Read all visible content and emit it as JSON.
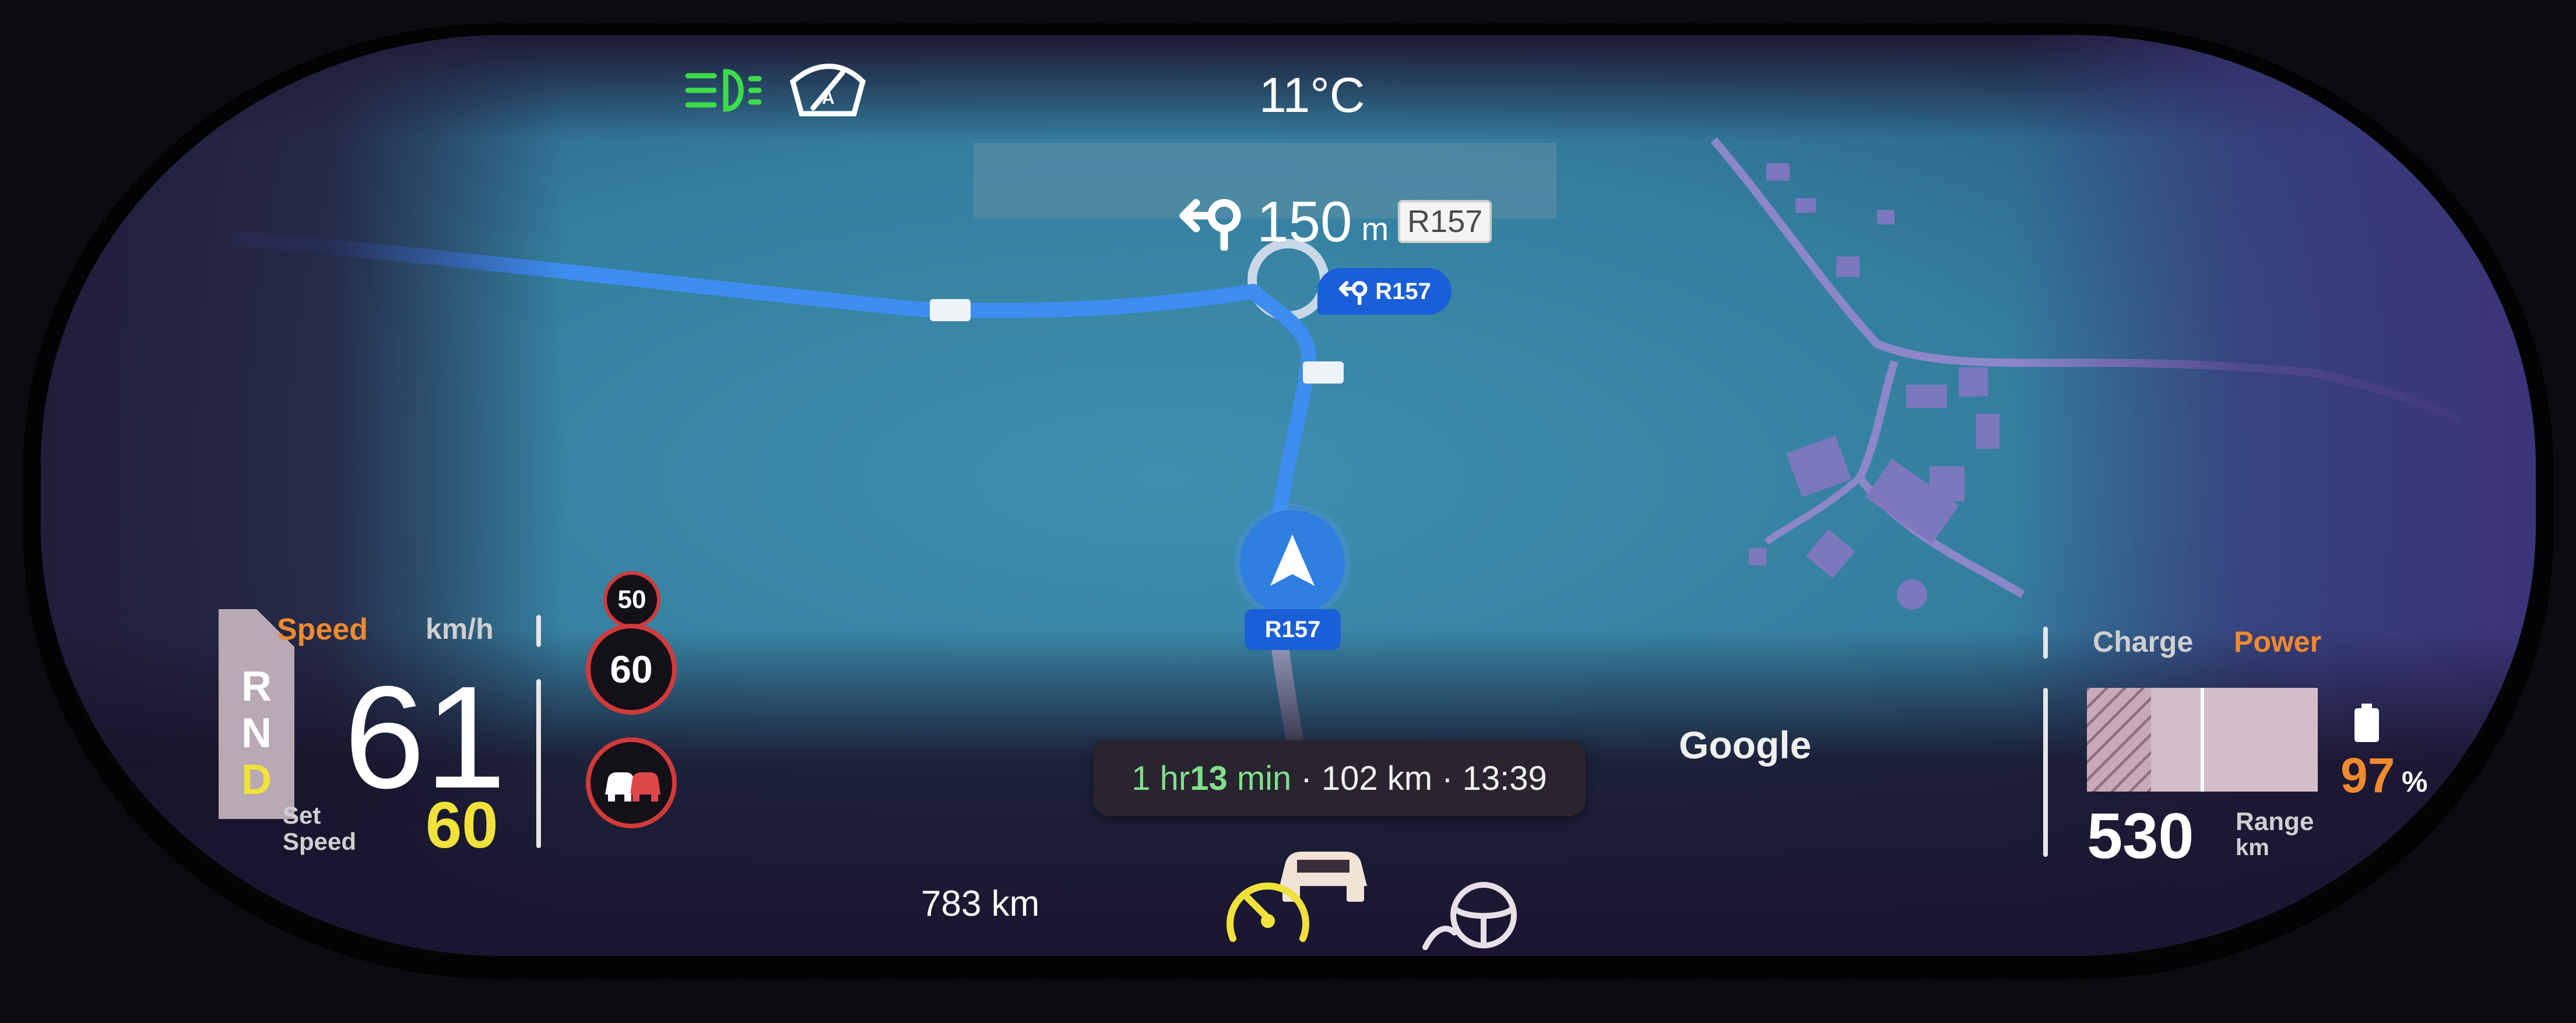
{
  "top": {
    "temperature": "11°C"
  },
  "navigation": {
    "distance_value": "150",
    "distance_unit": "m",
    "road_plate": "R157",
    "map_badge_turn": "R157",
    "map_badge_current": "R157",
    "eta": {
      "duration_prefix": "1 hr ",
      "duration_num": "13",
      "duration_suffix": " min",
      "sep1": " · ",
      "distance": "102 km",
      "sep2": " · ",
      "arrival": "13:39"
    },
    "map_attribution": "Google"
  },
  "speed": {
    "label": "Speed",
    "unit": "km/h",
    "current": "61",
    "set_label_1": "Set",
    "set_label_2": "Speed",
    "set_value": "60"
  },
  "gears": {
    "r": "R",
    "n": "N",
    "d": "D"
  },
  "signs": {
    "upcoming_limit": "50",
    "current_limit": "60"
  },
  "odometer": "783 km",
  "power": {
    "charge_label": "Charge",
    "power_label": "Power",
    "range_value": "530",
    "range_label_1": "Range",
    "range_label_2": "km",
    "battery_percent": "97",
    "battery_percent_sign": "%",
    "battery_level": 0.97
  },
  "icons": {
    "headlight": "headlight-icon",
    "wiper": "auto-wiper-icon",
    "nav_arrow": "nav-position-arrow-icon",
    "turn": "turn-left-roundabout-icon",
    "cruise": "adaptive-cruise-icon",
    "steering": "steering-assist-icon",
    "car_ahead": "car-ahead-icon",
    "lane_cars": "lane-cars-icon",
    "battery": "battery-icon"
  },
  "colors": {
    "route_blue": "#3d8ef0",
    "accent_orange": "#f08a2e",
    "set_yellow": "#f0e23a",
    "eta_green": "#7fe08a",
    "headlight_green": "#3ddc4a",
    "limit_red": "#d23a3a"
  }
}
